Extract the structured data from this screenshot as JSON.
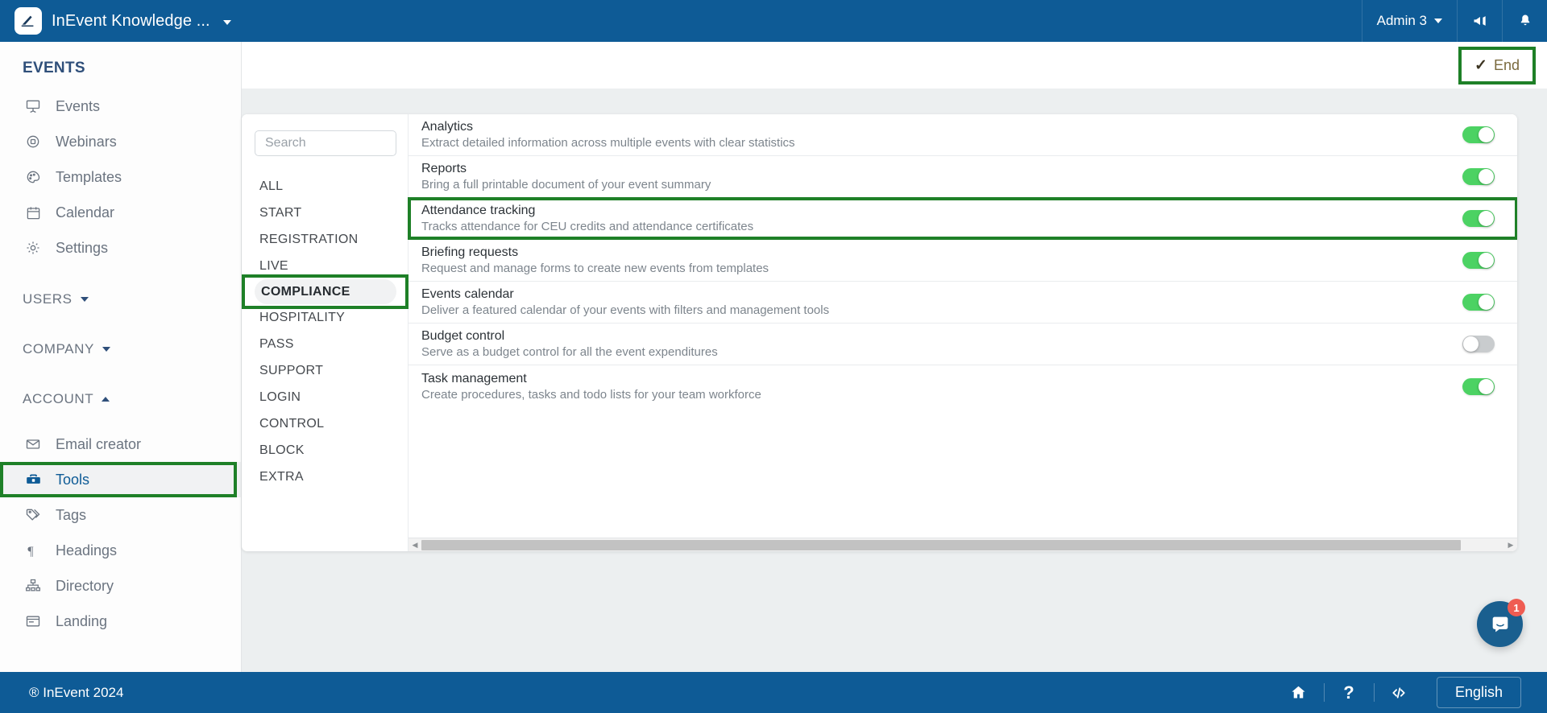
{
  "topbar": {
    "brand_title": "InEvent Knowledge ...",
    "logo_icon": "inevent-logo-icon",
    "brand_caret_icon": "chevron-down-icon",
    "user_label": "Admin 3",
    "user_caret_icon": "chevron-down-icon",
    "announcement_icon": "megaphone-icon",
    "notifications_icon": "bell-icon"
  },
  "sidebar": {
    "heading": "EVENTS",
    "items": [
      {
        "label": "Events",
        "icon": "presentation-screen-icon",
        "active": false
      },
      {
        "label": "Webinars",
        "icon": "webinar-icon",
        "active": false
      },
      {
        "label": "Templates",
        "icon": "palette-icon",
        "active": false
      },
      {
        "label": "Calendar",
        "icon": "calendar-icon",
        "active": false
      },
      {
        "label": "Settings",
        "icon": "gear-icon",
        "active": false
      }
    ],
    "groups": [
      {
        "label": "USERS",
        "expanded": false
      },
      {
        "label": "COMPANY",
        "expanded": false
      },
      {
        "label": "ACCOUNT",
        "expanded": true
      }
    ],
    "account_items": [
      {
        "label": "Email creator",
        "icon": "envelope-icon",
        "active": false,
        "highlighted": false
      },
      {
        "label": "Tools",
        "icon": "toolbox-icon",
        "active": true,
        "highlighted": true
      },
      {
        "label": "Tags",
        "icon": "tags-icon",
        "active": false,
        "highlighted": false
      },
      {
        "label": "Headings",
        "icon": "paragraph-icon",
        "active": false,
        "highlighted": false
      },
      {
        "label": "Directory",
        "icon": "org-chart-icon",
        "active": false,
        "highlighted": false
      },
      {
        "label": "Landing",
        "icon": "landing-page-icon",
        "active": false,
        "highlighted": false
      }
    ]
  },
  "workheader": {
    "end_label": "End",
    "end_icon": "check-icon"
  },
  "search": {
    "placeholder": "Search",
    "value": ""
  },
  "categories": [
    {
      "label": "ALL",
      "selected": false,
      "highlighted": false
    },
    {
      "label": "START",
      "selected": false,
      "highlighted": false
    },
    {
      "label": "REGISTRATION",
      "selected": false,
      "highlighted": false
    },
    {
      "label": "LIVE",
      "selected": false,
      "highlighted": false
    },
    {
      "label": "COMPLIANCE",
      "selected": true,
      "highlighted": true
    },
    {
      "label": "HOSPITALITY",
      "selected": false,
      "highlighted": false
    },
    {
      "label": "PASS",
      "selected": false,
      "highlighted": false
    },
    {
      "label": "SUPPORT",
      "selected": false,
      "highlighted": false
    },
    {
      "label": "LOGIN",
      "selected": false,
      "highlighted": false
    },
    {
      "label": "CONTROL",
      "selected": false,
      "highlighted": false
    },
    {
      "label": "BLOCK",
      "selected": false,
      "highlighted": false
    },
    {
      "label": "EXTRA",
      "selected": false,
      "highlighted": false
    }
  ],
  "tools": [
    {
      "title": "Analytics",
      "description": "Extract detailed information across multiple events with clear statistics",
      "enabled": true,
      "highlighted": false
    },
    {
      "title": "Reports",
      "description": "Bring a full printable document of your event summary",
      "enabled": true,
      "highlighted": false
    },
    {
      "title": "Attendance tracking",
      "description": "Tracks attendance for CEU credits and attendance certificates",
      "enabled": true,
      "highlighted": true
    },
    {
      "title": "Briefing requests",
      "description": "Request and manage forms to create new events from templates",
      "enabled": true,
      "highlighted": false
    },
    {
      "title": "Events calendar",
      "description": "Deliver a featured calendar of your events with filters and management tools",
      "enabled": true,
      "highlighted": false
    },
    {
      "title": "Budget control",
      "description": "Serve as a budget control for all the event expenditures",
      "enabled": false,
      "highlighted": false
    },
    {
      "title": "Task management",
      "description": "Create procedures, tasks and todo lists for your team workforce",
      "enabled": true,
      "highlighted": false
    }
  ],
  "chat_widget": {
    "icon": "intercom-chat-icon",
    "badge_count": "1"
  },
  "footer": {
    "copyright": "® InEvent 2024",
    "home_icon": "home-icon",
    "help_icon": "question-mark-icon",
    "code_icon": "code-brackets-icon",
    "language_label": "English"
  },
  "colors": {
    "brand_blue": "#0e5b96",
    "highlight_green": "#1e8027",
    "toggle_on": "#4cd263",
    "toggle_off": "#c9ccce",
    "badge_red": "#ef5c52"
  }
}
